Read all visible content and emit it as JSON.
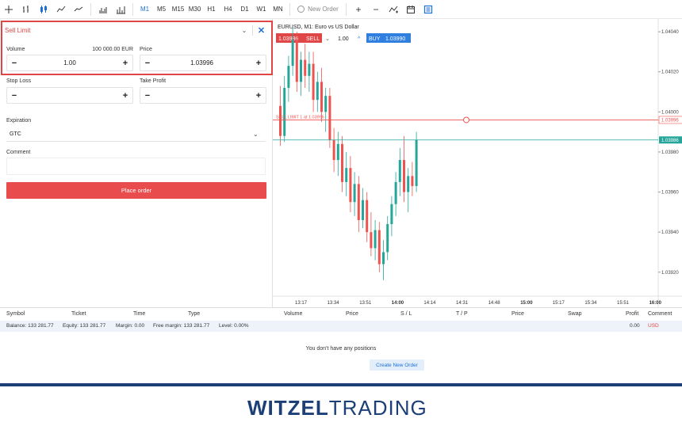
{
  "toolbar": {
    "timeframes": [
      "M1",
      "M5",
      "M15",
      "M30",
      "H1",
      "H4",
      "D1",
      "W1",
      "MN"
    ],
    "active_timeframe": "M1",
    "new_order_label": "New Order",
    "plus_label": "+",
    "minus_label": "−"
  },
  "order_panel": {
    "order_type": "Sell Limit",
    "close_glyph": "✕",
    "chevron_glyph": "⌄",
    "volume_label": "Volume",
    "volume_value": "1.00",
    "volume_note": "100 000.00 EUR",
    "price_label": "Price",
    "price_value": "1.03996",
    "stop_loss_label": "Stop Loss",
    "stop_loss_value": "",
    "take_profit_label": "Take Profit",
    "take_profit_value": "",
    "expiration_label": "Expiration",
    "expiration_value": "GTC",
    "comment_label": "Comment",
    "comment_value": "",
    "place_order_label": "Place order",
    "minus_glyph": "−",
    "plus_glyph": "+"
  },
  "chart": {
    "title": "EURUSD, M1: Euro vs US Dollar",
    "sell_price": "1.03986",
    "sell_label": "SELL",
    "quantity": "1.00",
    "buy_label": "BUY",
    "buy_price": "1.03990",
    "limit_order_label": "SELL LIMIT 1 at 1.03996",
    "limit_price_tag": "1.03996",
    "current_price_tag": "1.03986",
    "colors": {
      "up": "#26a69a",
      "down": "#ef5350",
      "limit_line": "#ef5350",
      "price_line": "#26a69a",
      "buy": "#2f7fe0",
      "sell": "#e04646"
    }
  },
  "chart_data": {
    "type": "candlestick",
    "price_axis": [
      "1.04040",
      "1.04020",
      "1.04000",
      "1.03980",
      "1.03960",
      "1.03940",
      "1.03920"
    ],
    "time_axis": [
      "13:17",
      "13:34",
      "13:51",
      "14:00",
      "14:14",
      "14:31",
      "14:48",
      "15:00",
      "15:17",
      "15:34",
      "15:51",
      "16:00"
    ],
    "time_axis_bold": [
      "14:00",
      "15:00",
      "16:00"
    ],
    "ylim": [
      1.03912,
      1.04044
    ],
    "limit_price": 1.03996,
    "current_price": 1.03986,
    "candles": [
      [
        1.04003,
        1.04013,
        1.03983,
        1.03988
      ],
      [
        1.03988,
        1.04018,
        1.03985,
        1.04012
      ],
      [
        1.04012,
        1.04028,
        1.04005,
        1.04023
      ],
      [
        1.04023,
        1.04042,
        1.04018,
        1.04036
      ],
      [
        1.04036,
        1.0404,
        1.0401,
        1.04015
      ],
      [
        1.04015,
        1.0403,
        1.04008,
        1.04026
      ],
      [
        1.04026,
        1.04034,
        1.04012,
        1.04018
      ],
      [
        1.04018,
        1.0403,
        1.0401,
        1.04024
      ],
      [
        1.04024,
        1.0403,
        1.04,
        1.04006
      ],
      [
        1.04006,
        1.0402,
        1.04,
        1.04015
      ],
      [
        1.04015,
        1.04022,
        1.03995,
        1.04
      ],
      [
        1.04,
        1.04012,
        1.0399,
        1.04008
      ],
      [
        1.04008,
        1.04012,
        1.03982,
        1.03986
      ],
      [
        1.03986,
        1.03992,
        1.0397,
        1.03976
      ],
      [
        1.03976,
        1.0399,
        1.03968,
        1.03984
      ],
      [
        1.03984,
        1.03988,
        1.0396,
        1.03965
      ],
      [
        1.03965,
        1.0398,
        1.03958,
        1.03972
      ],
      [
        1.03972,
        1.03978,
        1.0395,
        1.03955
      ],
      [
        1.03955,
        1.0397,
        1.03948,
        1.03964
      ],
      [
        1.03964,
        1.03968,
        1.0394,
        1.03946
      ],
      [
        1.03946,
        1.03962,
        1.03942,
        1.03956
      ],
      [
        1.03956,
        1.0396,
        1.03935,
        1.0394
      ],
      [
        1.0394,
        1.0395,
        1.03928,
        1.03932
      ],
      [
        1.03932,
        1.03946,
        1.03926,
        1.03941
      ],
      [
        1.03941,
        1.03945,
        1.0392,
        1.03924
      ],
      [
        1.03924,
        1.03936,
        1.03916,
        1.0393
      ],
      [
        1.0393,
        1.03948,
        1.03926,
        1.03944
      ],
      [
        1.03944,
        1.03958,
        1.03938,
        1.03954
      ],
      [
        1.03954,
        1.0397,
        1.03948,
        1.03965
      ],
      [
        1.03965,
        1.03982,
        1.03958,
        1.03976
      ],
      [
        1.03976,
        1.03988,
        1.03955,
        1.0396
      ],
      [
        1.0396,
        1.03972,
        1.0395,
        1.03968
      ],
      [
        1.03968,
        1.03975,
        1.03958,
        1.03963
      ],
      [
        1.03963,
        1.0399,
        1.0396,
        1.03986
      ]
    ]
  },
  "positions": {
    "columns": [
      "Symbol",
      "Ticket",
      "Time",
      "Type",
      "Volume",
      "Price",
      "S / L",
      "T / P",
      "Price",
      "Swap",
      "Profit",
      "Comment"
    ],
    "balance": "Balance: 133 281.77",
    "equity": "Equity: 133 281.77",
    "margin": "Margin: 0.00",
    "free_margin": "Free margin: 133 281.77",
    "level": "Level: 0.00%",
    "profit": "0.00",
    "currency": "USD",
    "empty_message": "You don't have any positions",
    "create_button": "Create New Order"
  },
  "branding": {
    "logo_bold": "WITZEL",
    "logo_light": "TRADING"
  }
}
